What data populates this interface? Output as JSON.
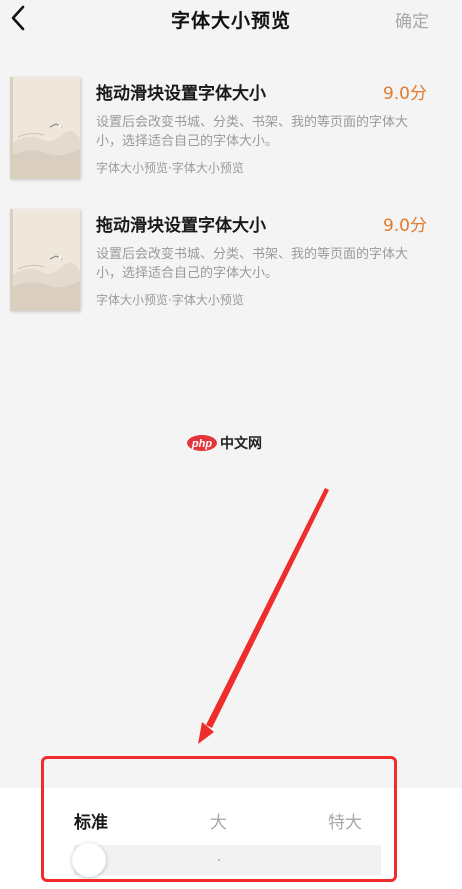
{
  "header": {
    "title": "字体大小预览",
    "confirm_label": "确定"
  },
  "books": [
    {
      "title": "拖动滑块设置字体大小",
      "score": "9.0分",
      "description": "设置后会改变书城、分类、书架、我的等页面的字体大小，选择适合自己的字体大小。",
      "tags": "字体大小预览·字体大小预览"
    },
    {
      "title": "拖动滑块设置字体大小",
      "score": "9.0分",
      "description": "设置后会改变书城、分类、书架、我的等页面的字体大小，选择适合自己的字体大小。",
      "tags": "字体大小预览·字体大小预览"
    }
  ],
  "watermark": {
    "brand": "php",
    "text": "中文网"
  },
  "size_panel": {
    "options": [
      "标准",
      "大",
      "特大"
    ],
    "selected": "标准"
  },
  "colors": {
    "score": "#e07a2e",
    "annotation": "#ef2d2d",
    "watermark_brand": "#e2363a"
  },
  "icons": {
    "back": "chevron-left-icon"
  }
}
